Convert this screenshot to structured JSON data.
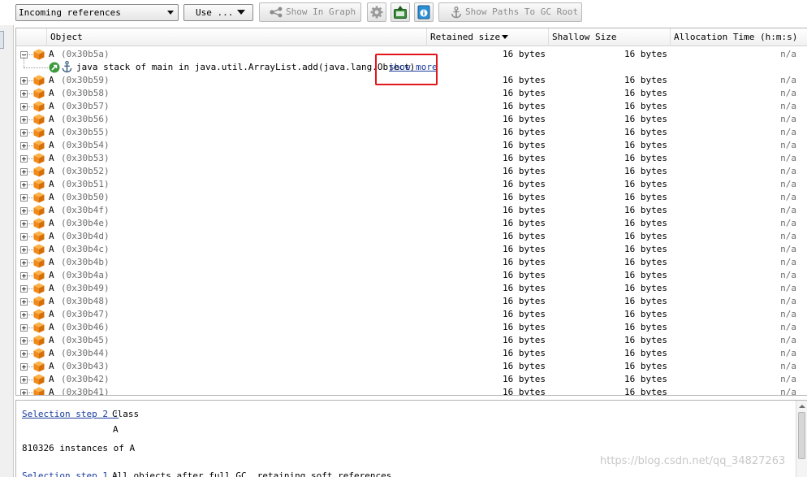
{
  "toolbar": {
    "references_combo": "Incoming references",
    "use_combo": "Use ...",
    "show_in_graph": "Show In Graph",
    "show_paths": "Show Paths To GC Root",
    "gear_icon": "gear-icon",
    "export_icon": "export-icon",
    "info_icon": "info-icon"
  },
  "table": {
    "columns": {
      "object": "Object",
      "retained": "Retained size",
      "shallow": "Shallow Size",
      "alloc": "Allocation Time (h:m:s)"
    },
    "expanded_row": {
      "name": "A",
      "addr": "(0x30b5a)",
      "retained": "16 bytes",
      "shallow": "16 bytes",
      "alloc": "n/a"
    },
    "stack_row": {
      "text": "java stack of main in java.util.ArrayList.add(java.lang.Object)",
      "link": "show more"
    },
    "rows": [
      {
        "name": "A",
        "addr": "(0x30b59)",
        "retained": "16 bytes",
        "shallow": "16 bytes",
        "alloc": "n/a"
      },
      {
        "name": "A",
        "addr": "(0x30b58)",
        "retained": "16 bytes",
        "shallow": "16 bytes",
        "alloc": "n/a"
      },
      {
        "name": "A",
        "addr": "(0x30b57)",
        "retained": "16 bytes",
        "shallow": "16 bytes",
        "alloc": "n/a"
      },
      {
        "name": "A",
        "addr": "(0x30b56)",
        "retained": "16 bytes",
        "shallow": "16 bytes",
        "alloc": "n/a"
      },
      {
        "name": "A",
        "addr": "(0x30b55)",
        "retained": "16 bytes",
        "shallow": "16 bytes",
        "alloc": "n/a"
      },
      {
        "name": "A",
        "addr": "(0x30b54)",
        "retained": "16 bytes",
        "shallow": "16 bytes",
        "alloc": "n/a"
      },
      {
        "name": "A",
        "addr": "(0x30b53)",
        "retained": "16 bytes",
        "shallow": "16 bytes",
        "alloc": "n/a"
      },
      {
        "name": "A",
        "addr": "(0x30b52)",
        "retained": "16 bytes",
        "shallow": "16 bytes",
        "alloc": "n/a"
      },
      {
        "name": "A",
        "addr": "(0x30b51)",
        "retained": "16 bytes",
        "shallow": "16 bytes",
        "alloc": "n/a"
      },
      {
        "name": "A",
        "addr": "(0x30b50)",
        "retained": "16 bytes",
        "shallow": "16 bytes",
        "alloc": "n/a"
      },
      {
        "name": "A",
        "addr": "(0x30b4f)",
        "retained": "16 bytes",
        "shallow": "16 bytes",
        "alloc": "n/a"
      },
      {
        "name": "A",
        "addr": "(0x30b4e)",
        "retained": "16 bytes",
        "shallow": "16 bytes",
        "alloc": "n/a"
      },
      {
        "name": "A",
        "addr": "(0x30b4d)",
        "retained": "16 bytes",
        "shallow": "16 bytes",
        "alloc": "n/a"
      },
      {
        "name": "A",
        "addr": "(0x30b4c)",
        "retained": "16 bytes",
        "shallow": "16 bytes",
        "alloc": "n/a"
      },
      {
        "name": "A",
        "addr": "(0x30b4b)",
        "retained": "16 bytes",
        "shallow": "16 bytes",
        "alloc": "n/a"
      },
      {
        "name": "A",
        "addr": "(0x30b4a)",
        "retained": "16 bytes",
        "shallow": "16 bytes",
        "alloc": "n/a"
      },
      {
        "name": "A",
        "addr": "(0x30b49)",
        "retained": "16 bytes",
        "shallow": "16 bytes",
        "alloc": "n/a"
      },
      {
        "name": "A",
        "addr": "(0x30b48)",
        "retained": "16 bytes",
        "shallow": "16 bytes",
        "alloc": "n/a"
      },
      {
        "name": "A",
        "addr": "(0x30b47)",
        "retained": "16 bytes",
        "shallow": "16 bytes",
        "alloc": "n/a"
      },
      {
        "name": "A",
        "addr": "(0x30b46)",
        "retained": "16 bytes",
        "shallow": "16 bytes",
        "alloc": "n/a"
      },
      {
        "name": "A",
        "addr": "(0x30b45)",
        "retained": "16 bytes",
        "shallow": "16 bytes",
        "alloc": "n/a"
      },
      {
        "name": "A",
        "addr": "(0x30b44)",
        "retained": "16 bytes",
        "shallow": "16 bytes",
        "alloc": "n/a"
      },
      {
        "name": "A",
        "addr": "(0x30b43)",
        "retained": "16 bytes",
        "shallow": "16 bytes",
        "alloc": "n/a"
      },
      {
        "name": "A",
        "addr": "(0x30b42)",
        "retained": "16 bytes",
        "shallow": "16 bytes",
        "alloc": "n/a"
      },
      {
        "name": "A",
        "addr": "(0x30b41)",
        "retained": "16 bytes",
        "shallow": "16 bytes",
        "alloc": "n/a"
      }
    ]
  },
  "bottom": {
    "step2_link": "Selection step 2 :",
    "step2_value": "Class",
    "class_name": "A",
    "instances": "810326 instances of A",
    "step1_link": "Selection step 1 :",
    "step1_value": "All objects after full GC, retaining soft references"
  },
  "watermark": "https://blog.csdn.net/qq_34827263",
  "colors": {
    "highlight": "#e1171c",
    "link": "#1a3c9c",
    "cube": "#f08a1a"
  }
}
